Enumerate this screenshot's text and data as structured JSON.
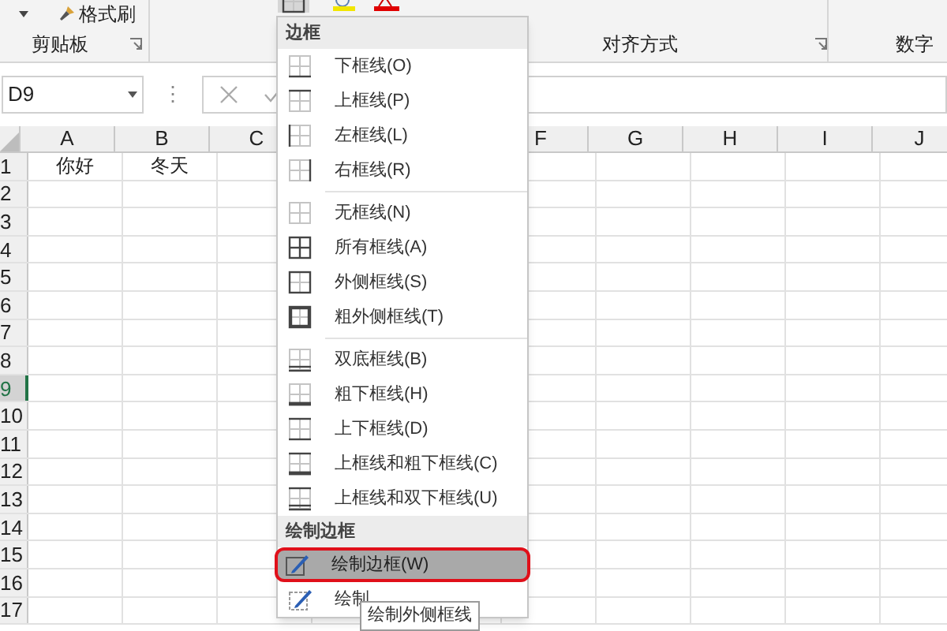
{
  "ribbon": {
    "format_painter": "格式刷",
    "groups": [
      {
        "label": "剪贴板",
        "launcher": true
      },
      {
        "label": "对齐方式",
        "launcher": true
      },
      {
        "label": "数字",
        "launcher": false
      }
    ]
  },
  "formula_bar": {
    "name_box": "D9",
    "grip": "⋮"
  },
  "sheet": {
    "columns": [
      {
        "label": "A"
      },
      {
        "label": "B"
      },
      {
        "label": "C"
      },
      {
        "label": "F"
      },
      {
        "label": "G"
      },
      {
        "label": "H"
      },
      {
        "label": "I"
      },
      {
        "label": "J"
      }
    ],
    "rows": [
      {
        "label": "1",
        "selected": false,
        "cells": [
          "你好",
          "冬天"
        ]
      },
      {
        "label": "2",
        "selected": false
      },
      {
        "label": "3",
        "selected": false
      },
      {
        "label": "4",
        "selected": false
      },
      {
        "label": "5",
        "selected": false
      },
      {
        "label": "6",
        "selected": false
      },
      {
        "label": "7",
        "selected": false
      },
      {
        "label": "8",
        "selected": false
      },
      {
        "label": "9",
        "selected": true
      },
      {
        "label": "10",
        "selected": false
      },
      {
        "label": "11",
        "selected": false
      },
      {
        "label": "12",
        "selected": false
      },
      {
        "label": "13",
        "selected": false
      },
      {
        "label": "14",
        "selected": false
      },
      {
        "label": "15",
        "selected": false
      },
      {
        "label": "16",
        "selected": false
      },
      {
        "label": "17",
        "selected": false
      }
    ]
  },
  "border_menu": {
    "sections": [
      {
        "title": "边框",
        "groups": [
          [
            {
              "label": "下框线(O)",
              "kind": "bottom",
              "selected": false
            },
            {
              "label": "上框线(P)",
              "kind": "top",
              "selected": false
            },
            {
              "label": "左框线(L)",
              "kind": "left",
              "selected": false
            },
            {
              "label": "右框线(R)",
              "kind": "right",
              "selected": false
            }
          ],
          [
            {
              "label": "无框线(N)",
              "kind": "none",
              "selected": false
            },
            {
              "label": "所有框线(A)",
              "kind": "all",
              "selected": false
            },
            {
              "label": "外侧框线(S)",
              "kind": "outside",
              "selected": false
            },
            {
              "label": "粗外侧框线(T)",
              "kind": "thick",
              "selected": false
            }
          ],
          [
            {
              "label": "双底框线(B)",
              "kind": "double",
              "selected": false
            },
            {
              "label": "粗下框线(H)",
              "kind": "heavy",
              "selected": false
            },
            {
              "label": "上下框线(D)",
              "kind": "pair",
              "selected": false
            },
            {
              "label": "上框线和粗下框线(C)",
              "kind": "mixed",
              "selected": false
            },
            {
              "label": "上框线和双下框线(U)",
              "kind": "triple",
              "selected": false
            }
          ]
        ]
      },
      {
        "title": "绘制边框",
        "groups": [
          [
            {
              "label": "绘制边框(W)",
              "kind": "pencil",
              "selected": true
            },
            {
              "label": "绘制",
              "kind": "grid",
              "selected": false
            }
          ]
        ]
      }
    ]
  },
  "tooltip": "绘制外侧框线"
}
